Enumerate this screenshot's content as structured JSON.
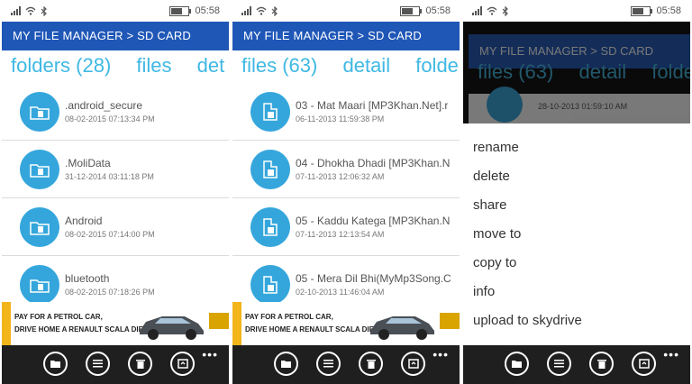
{
  "status": {
    "time": "05:58"
  },
  "header": {
    "title": "MY FILE MANAGER > SD CARD"
  },
  "screen1": {
    "pivot": [
      "folders (28)",
      "files",
      "det"
    ],
    "items": [
      {
        "name": ".android_secure",
        "date": "08-02-2015 07:13:34 PM"
      },
      {
        "name": ".MoliData",
        "date": "31-12-2014 03:11:18 PM"
      },
      {
        "name": "Android",
        "date": "08-02-2015 07:14:00 PM"
      },
      {
        "name": "bluetooth",
        "date": "08-02-2015 07:18:26 PM"
      }
    ]
  },
  "screen2": {
    "pivot": [
      "files (63)",
      "detail",
      "folde"
    ],
    "items": [
      {
        "name": "03 - Mat Maari [MP3Khan.Net].r",
        "date": "06-11-2013 11:59:38 PM"
      },
      {
        "name": "04 - Dhokha Dhadi [MP3Khan.N",
        "date": "07-11-2013 12:06:32 AM"
      },
      {
        "name": "05 - Kaddu Katega [MP3Khan.N",
        "date": "07-11-2013 12:13:54 AM"
      },
      {
        "name": "05 - Mera Dil Bhi(MyMp3Song.C",
        "date": "02-10-2013 11:46:04 AM"
      }
    ]
  },
  "screen3": {
    "pivot": [
      "files (63)",
      "detail",
      "folde"
    ],
    "peek_date": "28-10-2013 01:59:10 AM",
    "menu": [
      "rename",
      "delete",
      "share",
      "move to",
      "copy to",
      "info",
      "upload to skydrive"
    ]
  },
  "ad": {
    "line1": "PAY FOR A PETROL CAR,",
    "line2": "DRIVE HOME A RENAULT SCALA DIESEL."
  },
  "colors": {
    "accent": "#1f57b7",
    "pivot": "#3fb8e3",
    "icon_circle": "#34a6dc",
    "command_bar": "#1f1f1f"
  },
  "icons": [
    "signal-icon",
    "wifi-icon",
    "bluetooth-icon",
    "battery-icon",
    "folder-icon",
    "document-icon",
    "add-folder-icon",
    "list-icon",
    "delete-icon",
    "sync-icon",
    "more-icon"
  ]
}
